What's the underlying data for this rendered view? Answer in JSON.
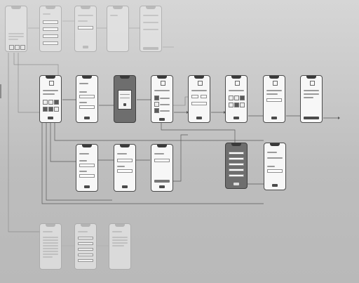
{
  "diagram": {
    "title": "",
    "background": "#c8c8c8",
    "phone_styles": {
      "normal": "#f7f7f7",
      "faded": "#e4e4e4",
      "dark": "#6e6e6e"
    },
    "screens": [
      {
        "id": "s-top-home",
        "style": "faded",
        "kind": "home"
      },
      {
        "id": "s-top-list",
        "style": "faded",
        "kind": "grid"
      },
      {
        "id": "s-top-form",
        "style": "faded",
        "kind": "form"
      },
      {
        "id": "s-top-blank",
        "style": "faded",
        "kind": "blank"
      },
      {
        "id": "s-top-detail",
        "style": "faded",
        "kind": "form"
      },
      {
        "id": "s-r1-grid",
        "style": "normal",
        "kind": "grid"
      },
      {
        "id": "s-r1-form",
        "style": "normal",
        "kind": "form"
      },
      {
        "id": "s-r1-modal",
        "style": "dark",
        "kind": "modal"
      },
      {
        "id": "s-r1-checks",
        "style": "normal",
        "kind": "checks"
      },
      {
        "id": "s-r1-select",
        "style": "normal",
        "kind": "form"
      },
      {
        "id": "s-r1-options",
        "style": "normal",
        "kind": "checks"
      },
      {
        "id": "s-r1-confirm",
        "style": "normal",
        "kind": "form"
      },
      {
        "id": "s-r1-done",
        "style": "normal",
        "kind": "text"
      },
      {
        "id": "s-r2-form",
        "style": "normal",
        "kind": "form"
      },
      {
        "id": "s-r2-input",
        "style": "normal",
        "kind": "form"
      },
      {
        "id": "s-r2-select",
        "style": "normal",
        "kind": "form"
      },
      {
        "id": "s-r2-menu",
        "style": "dark",
        "kind": "menu"
      },
      {
        "id": "s-r2-form2",
        "style": "normal",
        "kind": "form"
      },
      {
        "id": "s-r3-text",
        "style": "faded",
        "kind": "text"
      },
      {
        "id": "s-r3-list",
        "style": "faded",
        "kind": "list"
      },
      {
        "id": "s-r3-text2",
        "style": "faded",
        "kind": "text"
      }
    ]
  }
}
